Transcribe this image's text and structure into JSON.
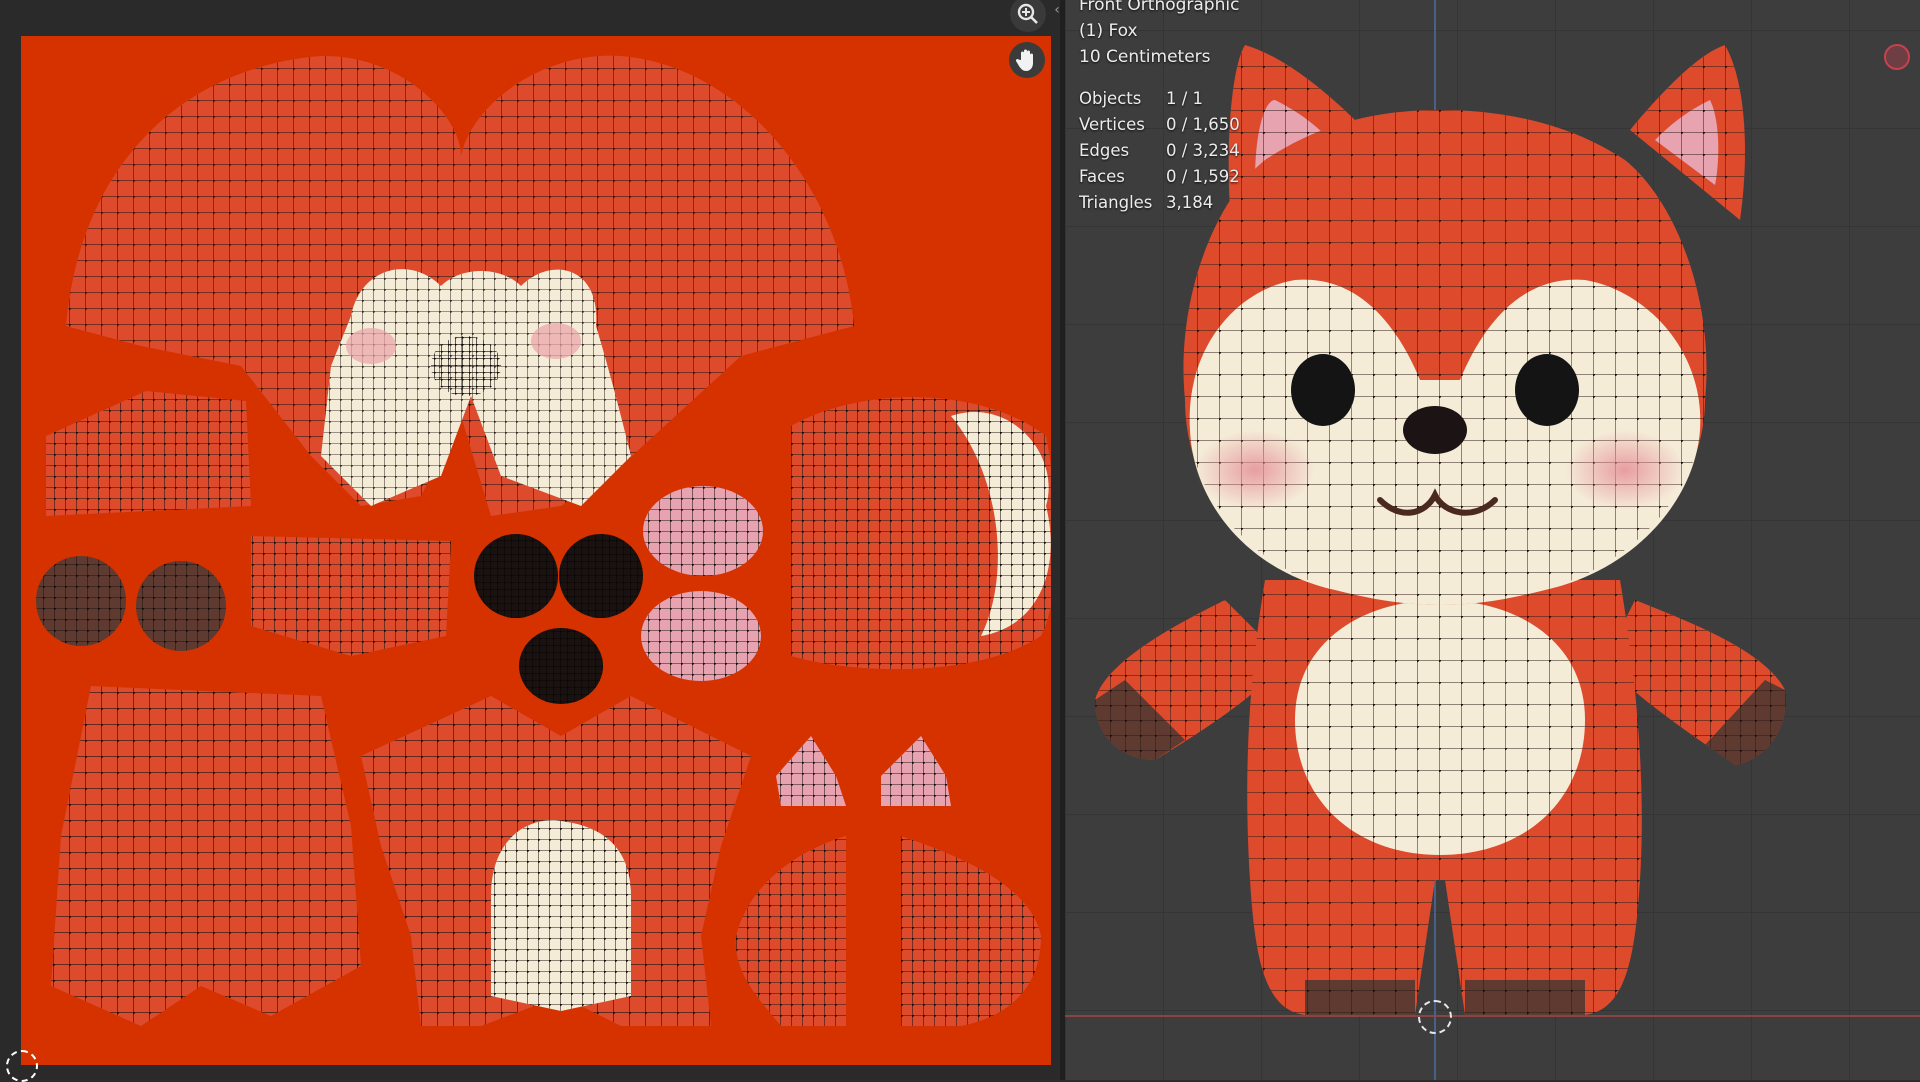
{
  "viewport": {
    "view_name": "Front Orthographic",
    "object_label": "(1) Fox",
    "scale_label": "10 Centimeters",
    "stats": [
      {
        "label": "Objects",
        "value": "1 / 1"
      },
      {
        "label": "Vertices",
        "value": "0 / 1,650"
      },
      {
        "label": "Edges",
        "value": "0 / 3,234"
      },
      {
        "label": "Faces",
        "value": "0 / 1,592"
      },
      {
        "label": "Triangles",
        "value": "3,184"
      }
    ]
  },
  "uv_editor": {
    "tools": [
      "zoom-icon",
      "hand-icon"
    ]
  },
  "colors": {
    "uv_background": "#d63200",
    "fox_orange": "#de4a2c",
    "fox_cream": "#f5ecd8",
    "ear_pink": "#e7a3b0",
    "paw_brown": "#5e3a30",
    "axis_blue": "#4a6a9c",
    "axis_red": "#9c4646"
  }
}
